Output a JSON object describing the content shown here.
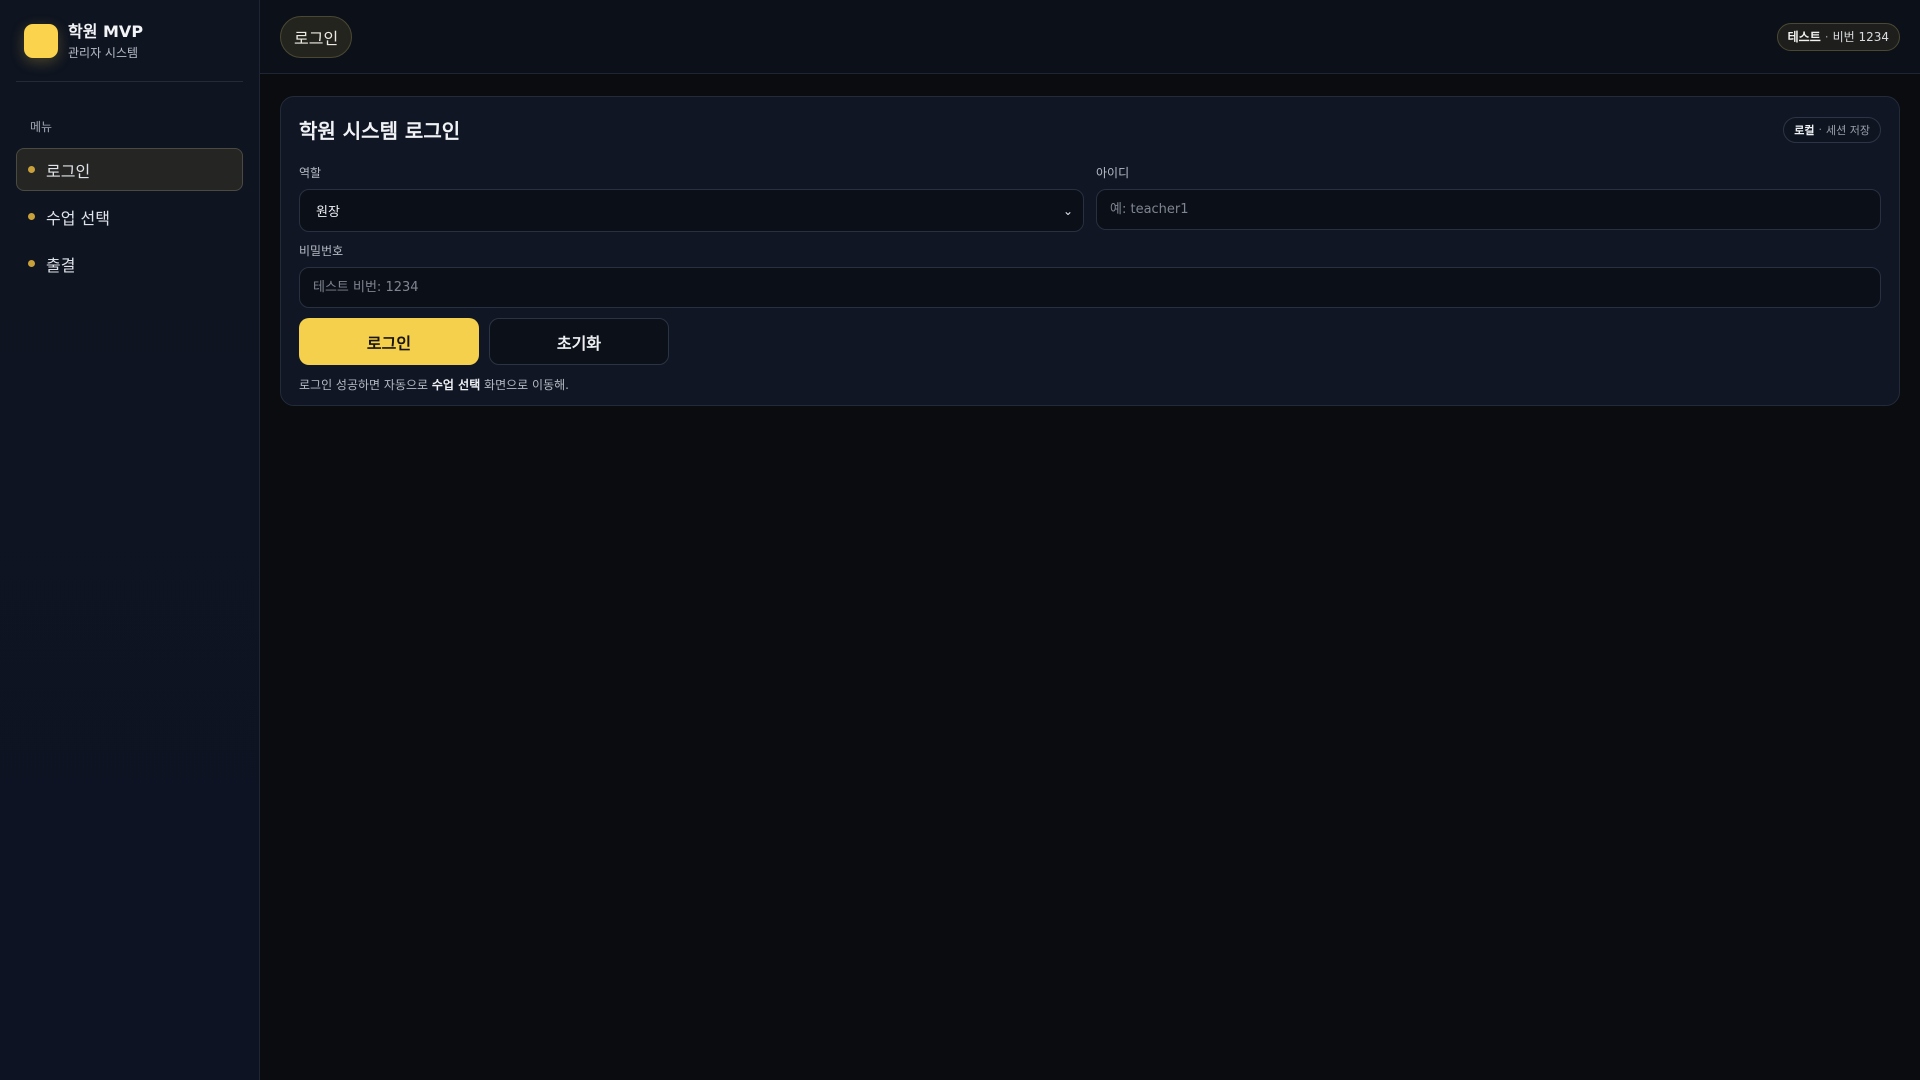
{
  "brand": {
    "title": "학원 MVP",
    "subtitle": "관리자 시스템",
    "logo_color": "#fcd34d"
  },
  "sidebar": {
    "section_label": "메뉴",
    "items": [
      {
        "label": "로그인",
        "active": true
      },
      {
        "label": "수업 선택",
        "active": false
      },
      {
        "label": "출결",
        "active": false
      }
    ]
  },
  "header": {
    "breadcrumb": "로그인",
    "test_badge": {
      "strong": "테스트",
      "separator": "·",
      "text": "비번 1234"
    }
  },
  "login_card": {
    "title": "학원 시스템 로그인",
    "session_badge": {
      "strong": "로컬",
      "separator": "·",
      "text": "세션 저장"
    },
    "role_label": "역할",
    "role_value": "원장",
    "id_label": "아이디",
    "id_placeholder": "예: teacher1",
    "password_label": "비밀번호",
    "password_placeholder": "테스트 비번: 1234",
    "login_button": "로그인",
    "reset_button": "초기화",
    "hint_before": "로그인 성공하면 자동으로 ",
    "hint_strong": "수업 선택",
    "hint_after": " 화면으로 이동해."
  },
  "colors": {
    "accent": "#f5d04c",
    "background": "#0a0c10",
    "card": "#101624"
  }
}
